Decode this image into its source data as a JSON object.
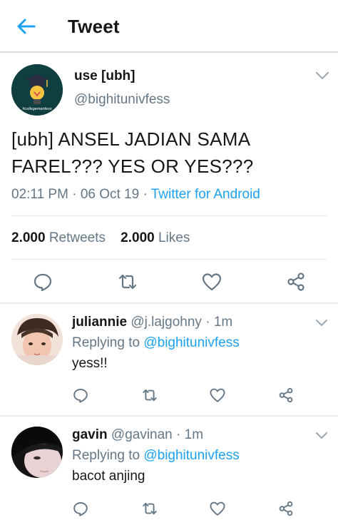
{
  "header": {
    "title": "Tweet"
  },
  "main_tweet": {
    "name": "use [ubh]",
    "handle": "@bighitunivfess",
    "avatar_caption": "#collegemanfess",
    "text": "[ubh] ANSEL JADIAN SAMA FAREL??? YES OR YES???",
    "time": "02:11 PM",
    "date": "06 Oct 19",
    "separator": " · ",
    "source": "Twitter for Android",
    "retweets_count": "2.000",
    "retweets_label": "Retweets",
    "likes_count": "2.000",
    "likes_label": "Likes"
  },
  "replies": [
    {
      "name": "juliannie",
      "handle": "@j.lajgohny",
      "time": "1m",
      "replying_label": "Replying to",
      "replying_to": "@bighitunivfess",
      "text": "yess!!"
    },
    {
      "name": "gavin",
      "handle": "@gavinan",
      "time": "1m",
      "replying_label": "Replying to",
      "replying_to": "@bighitunivfess",
      "text": "bacot anjing"
    }
  ],
  "colors": {
    "accent": "#1da1f2",
    "secondary_text": "#657786",
    "primary_text": "#14171a",
    "divider": "#e1e8ed"
  },
  "icons": {
    "back": "arrow-left-icon",
    "chevron": "chevron-down-icon",
    "reply": "comment-icon",
    "retweet": "retweet-icon",
    "like": "heart-icon",
    "share": "share-icon"
  }
}
